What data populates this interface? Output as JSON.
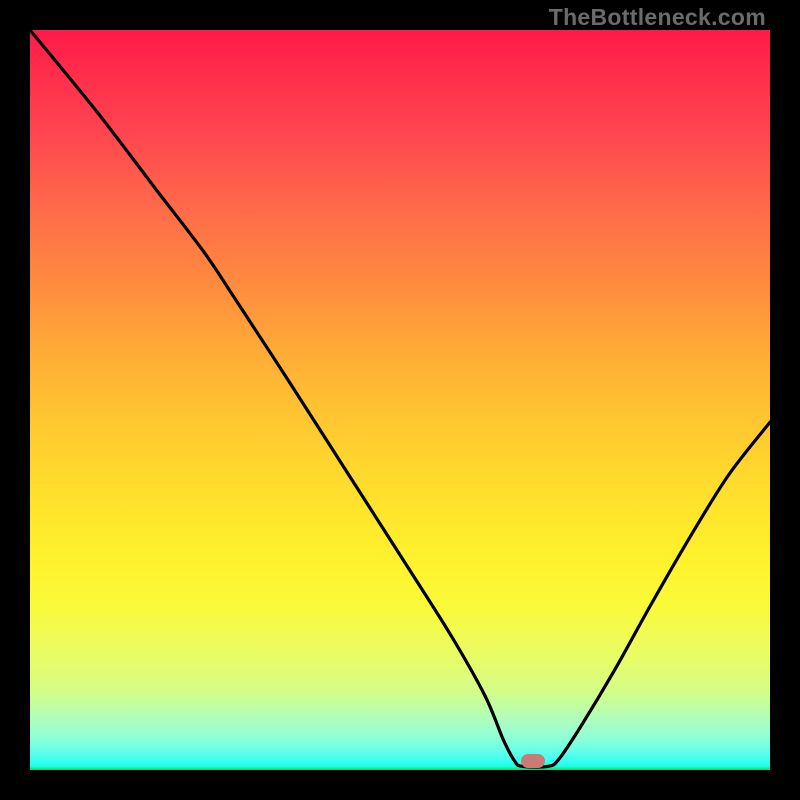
{
  "watermark": "TheBottleneck.com",
  "marker": {
    "cx_frac": 0.68,
    "cy_frac": 0.988
  },
  "chart_data": {
    "type": "line",
    "title": "",
    "xlabel": "",
    "ylabel": "",
    "xlim": [
      0,
      1
    ],
    "ylim": [
      0,
      1
    ],
    "series": [
      {
        "name": "bottleneck-curve",
        "points": [
          {
            "x": 0.0,
            "y": 1.0
          },
          {
            "x": 0.09,
            "y": 0.89
          },
          {
            "x": 0.17,
            "y": 0.785
          },
          {
            "x": 0.235,
            "y": 0.7
          },
          {
            "x": 0.275,
            "y": 0.64
          },
          {
            "x": 0.35,
            "y": 0.525
          },
          {
            "x": 0.43,
            "y": 0.4
          },
          {
            "x": 0.51,
            "y": 0.275
          },
          {
            "x": 0.57,
            "y": 0.18
          },
          {
            "x": 0.615,
            "y": 0.1
          },
          {
            "x": 0.64,
            "y": 0.04
          },
          {
            "x": 0.655,
            "y": 0.012
          },
          {
            "x": 0.665,
            "y": 0.005
          },
          {
            "x": 0.7,
            "y": 0.005
          },
          {
            "x": 0.715,
            "y": 0.015
          },
          {
            "x": 0.745,
            "y": 0.06
          },
          {
            "x": 0.79,
            "y": 0.135
          },
          {
            "x": 0.84,
            "y": 0.225
          },
          {
            "x": 0.895,
            "y": 0.32
          },
          {
            "x": 0.945,
            "y": 0.4
          },
          {
            "x": 1.0,
            "y": 0.47
          }
        ]
      }
    ],
    "gradient_stops": [
      {
        "pos": 0.0,
        "color": "#ff1a47"
      },
      {
        "pos": 0.5,
        "color": "#ffbf33"
      },
      {
        "pos": 0.8,
        "color": "#f5fc4a"
      },
      {
        "pos": 0.97,
        "color": "#60ffe6"
      },
      {
        "pos": 1.0,
        "color": "#07d97a"
      }
    ],
    "marker": {
      "x": 0.68,
      "y": 0.012,
      "color": "#c97b74"
    }
  }
}
